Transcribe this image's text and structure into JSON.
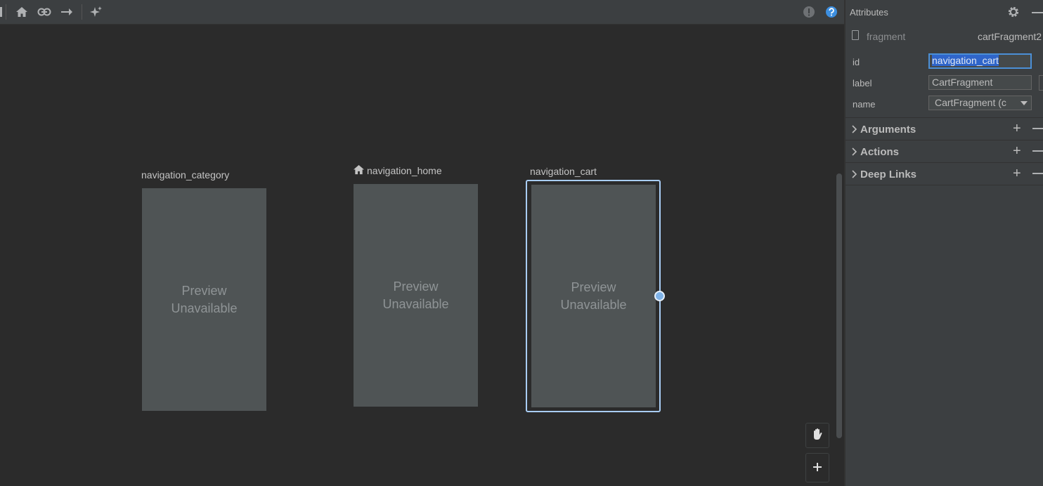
{
  "toolbar": {
    "icons": [
      "home-icon",
      "link-icon",
      "arrow-right-icon",
      "sparkle-icon"
    ],
    "right_icons": [
      "warning-icon",
      "help-icon"
    ],
    "colors": {
      "help": "#3d8fe0",
      "warning": "#6e7174"
    }
  },
  "canvas": {
    "nodes": [
      {
        "label": "navigation_category",
        "preview": "Preview\nUnavailable",
        "start": false,
        "selected": false
      },
      {
        "label": "navigation_home",
        "preview": "Preview\nUnavailable",
        "start": true,
        "selected": false
      },
      {
        "label": "navigation_cart",
        "preview": "Preview\nUnavailable",
        "start": false,
        "selected": true
      }
    ],
    "preview_line1": "Preview",
    "preview_line2": "Unavailable",
    "selection_color": "#a9cdf5",
    "float_buttons": [
      "hand-pan-icon",
      "zoom-in-plus-icon"
    ]
  },
  "attributes": {
    "title": "Attributes",
    "type": "fragment",
    "name": "cartFragment2",
    "fields": {
      "id_label": "id",
      "id_value": "navigation_cart",
      "label_label": "label",
      "label_value": "CartFragment",
      "name_label": "name",
      "name_value": "CartFragment (c"
    },
    "sections": [
      "Arguments",
      "Actions",
      "Deep Links"
    ]
  }
}
